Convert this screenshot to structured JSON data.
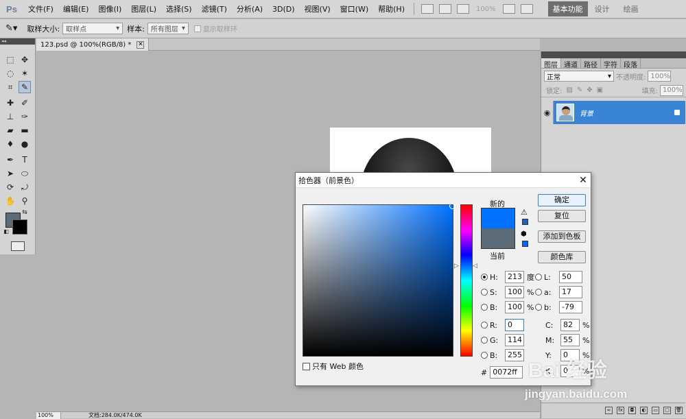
{
  "app": {
    "logo": "Ps"
  },
  "menu": [
    "文件(F)",
    "编辑(E)",
    "图像(I)",
    "图层(L)",
    "选择(S)",
    "滤镜(T)",
    "分析(A)",
    "3D(D)",
    "视图(V)",
    "窗口(W)",
    "帮助(H)"
  ],
  "menubar_right": {
    "zoom": "100%",
    "workspace": "基本功能",
    "design": "设计",
    "more": "绘画"
  },
  "options": {
    "sample_size_label": "取样大小:",
    "sample_size_value": "取样点",
    "sample_label": "样本:",
    "sample_value": "所有图层",
    "show_ring_label": "显示取样环"
  },
  "document": {
    "tab_title": "123.psd @ 100%(RGB/8) *"
  },
  "status": {
    "zoom": "100%",
    "info": "文档:284.0K/474.0K"
  },
  "layers_panel": {
    "tabs": [
      "图层",
      "通道",
      "路径",
      "字符",
      "段落"
    ],
    "blend_mode": "正常",
    "opacity_label": "不透明度:",
    "opacity_value": "100%",
    "lock_label": "锁定:",
    "fill_label": "填充:",
    "fill_value": "100%",
    "layer_name": "背景"
  },
  "color_picker": {
    "title": "拾色器（前景色）",
    "new_label": "新的",
    "current_label": "当前",
    "new_color": "#0072ff",
    "current_color": "#5b6b77",
    "buttons": {
      "ok": "确定",
      "reset": "复位",
      "add_swatch": "添加到色板",
      "color_library": "颜色库"
    },
    "web_only_label": "只有 Web 颜色",
    "hsb": [
      {
        "label": "H:",
        "value": "213",
        "unit": "度",
        "selected": true
      },
      {
        "label": "S:",
        "value": "100",
        "unit": "%",
        "selected": false
      },
      {
        "label": "B:",
        "value": "100",
        "unit": "%",
        "selected": false
      }
    ],
    "rgb": [
      {
        "label": "R:",
        "value": "0"
      },
      {
        "label": "G:",
        "value": "114"
      },
      {
        "label": "B:",
        "value": "255"
      }
    ],
    "lab": [
      {
        "label": "L:",
        "value": "50"
      },
      {
        "label": "a:",
        "value": "17"
      },
      {
        "label": "b:",
        "value": "-79"
      }
    ],
    "cmyk": [
      {
        "label": "C:",
        "value": "82",
        "unit": "%"
      },
      {
        "label": "M:",
        "value": "55",
        "unit": "%"
      },
      {
        "label": "Y:",
        "value": "0",
        "unit": "%"
      },
      {
        "label": "K:",
        "value": "0",
        "unit": "%"
      }
    ],
    "hex_label": "#",
    "hex_value": "0072ff"
  },
  "watermark": {
    "brand": "Bai 经验",
    "url": "jingyan.baidu.com"
  },
  "icons": {
    "tools": [
      "marquee-icon",
      "move-icon",
      "lasso-icon",
      "magic-wand-icon",
      "crop-icon",
      "eyedropper-icon",
      "healing-brush-icon",
      "brush-icon",
      "clone-stamp-icon",
      "history-brush-icon",
      "eraser-icon",
      "gradient-icon",
      "blur-icon",
      "dodge-icon",
      "pen-icon",
      "type-icon",
      "path-selection-icon",
      "shape-icon",
      "3d-rotate-icon",
      "3d-orbit-icon",
      "hand-icon",
      "zoom-icon"
    ]
  }
}
